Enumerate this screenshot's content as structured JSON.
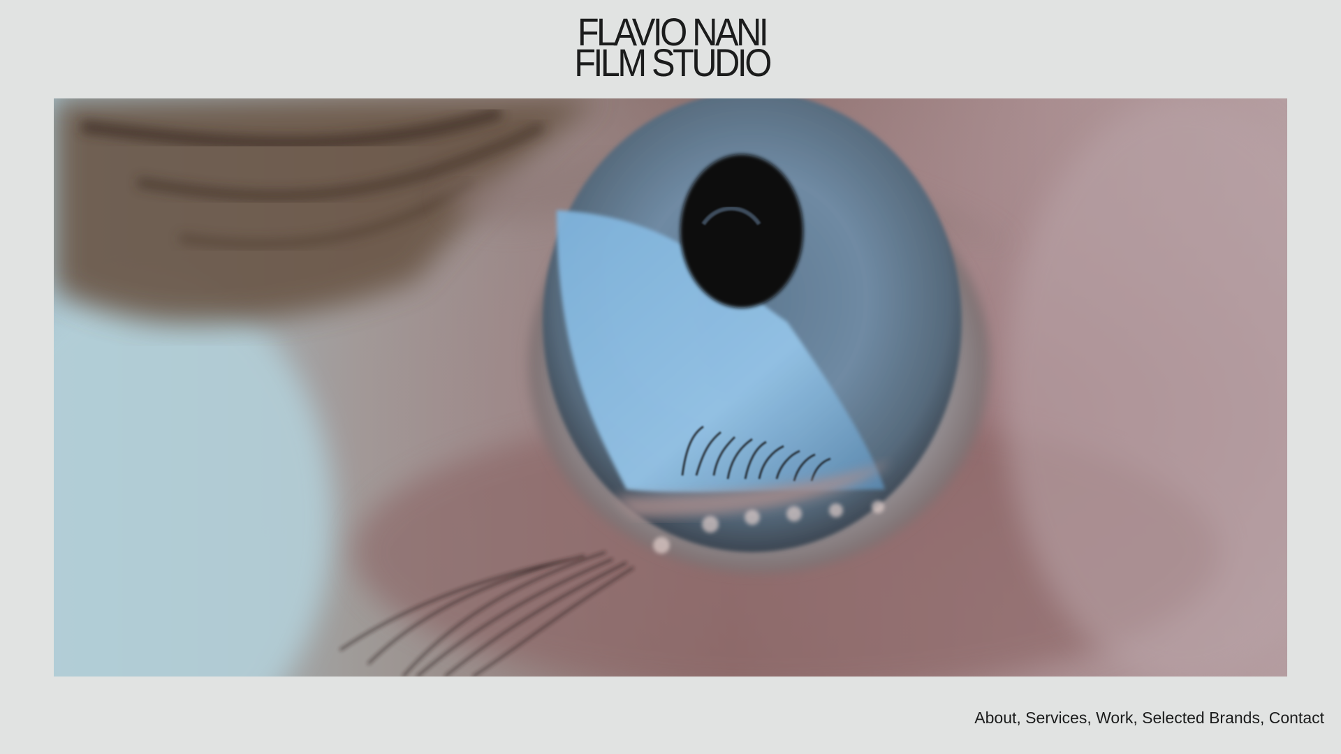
{
  "brand": {
    "line1": "FLAVIO NANI",
    "line2": "FILM STUDIO"
  },
  "hero": {
    "icon": "eye-closeup-image"
  },
  "nav": {
    "items": [
      {
        "label": "About",
        "sep": ","
      },
      {
        "label": "Services",
        "sep": ","
      },
      {
        "label": "Work",
        "sep": ","
      },
      {
        "label": "Selected Brands",
        "sep": ","
      },
      {
        "label": "Contact",
        "sep": ""
      }
    ]
  },
  "colors": {
    "background": "#e1e3e2",
    "text": "#1b1c1c"
  }
}
